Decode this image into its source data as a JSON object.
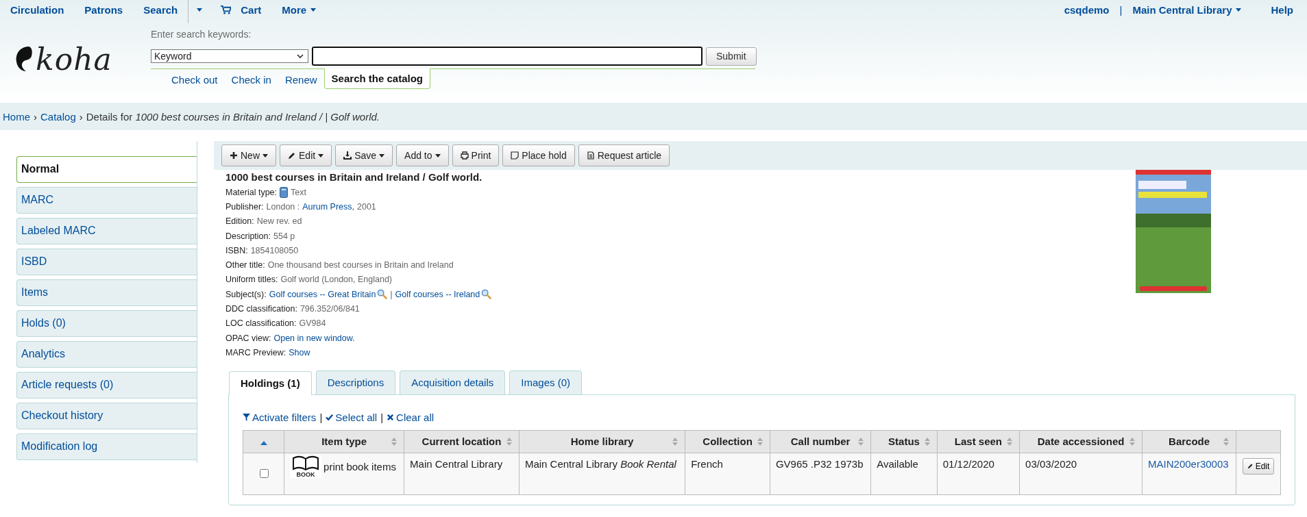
{
  "top_nav": {
    "items": [
      {
        "label": "Circulation",
        "dropdown": false
      },
      {
        "label": "Patrons",
        "dropdown": false
      },
      {
        "label": "Search",
        "dropdown": false
      },
      {
        "dropdown": true
      },
      {
        "label": "Cart",
        "dropdown": false
      },
      {
        "label": "More",
        "dropdown": true
      }
    ],
    "user": "csqdemo",
    "separator": "|",
    "library": "Main Central Library",
    "help": "Help"
  },
  "logo": {
    "text": "koha"
  },
  "search": {
    "label": "Enter search keywords:",
    "select_value": "Keyword",
    "submit": "Submit",
    "tabs": [
      {
        "label": "Check out",
        "selected": false
      },
      {
        "label": "Check in",
        "selected": false
      },
      {
        "label": "Renew",
        "selected": false
      },
      {
        "label": "Search the catalog",
        "selected": true
      }
    ]
  },
  "breadcrumb": {
    "links": [
      "Home",
      "Catalog"
    ],
    "separator": "›",
    "current": "Details for *1000 best courses in Britain and Ireland / | Golf world.*"
  },
  "sidebar": {
    "items": [
      {
        "label": "Normal",
        "selected": true
      },
      {
        "label": "MARC",
        "selected": false
      },
      {
        "label": "Labeled MARC",
        "selected": false
      },
      {
        "label": "ISBD",
        "selected": false
      },
      {
        "label": "Items",
        "selected": false
      },
      {
        "label": "Holds (0)",
        "selected": false
      },
      {
        "label": "Analytics",
        "selected": false
      },
      {
        "label": "Article requests (0)",
        "selected": false
      },
      {
        "label": "Checkout history",
        "selected": false
      },
      {
        "label": "Modification log",
        "selected": false
      }
    ]
  },
  "toolbar": [
    {
      "label": "New",
      "dropdown": true
    },
    {
      "label": "Edit",
      "dropdown": true
    },
    {
      "label": "Save",
      "dropdown": true
    },
    {
      "label": "Add to",
      "dropdown": true
    },
    {
      "label": "Print",
      "dropdown": false
    },
    {
      "label": "Place hold",
      "dropdown": false
    },
    {
      "label": "Request article",
      "dropdown": false
    }
  ],
  "record": {
    "title": "1000 best courses in Britain and Ireland / Golf world.",
    "fields": [
      {
        "label": "Material type:",
        "kind": "material",
        "parts": [
          {
            "text": "Text",
            "link": false,
            "search": false
          }
        ]
      },
      {
        "label": "Publisher:",
        "kind": "text",
        "parts": [
          {
            "text": "London :",
            "link": false,
            "search": false
          },
          {
            "text": "Aurum Press,",
            "link": true,
            "search": false
          },
          {
            "text": "2001",
            "link": false,
            "search": false
          }
        ]
      },
      {
        "label": "Edition:",
        "kind": "text",
        "parts": [
          {
            "text": "New rev. ed",
            "link": false,
            "search": false
          }
        ]
      },
      {
        "label": "Description:",
        "kind": "text",
        "parts": [
          {
            "text": "554 p",
            "link": false,
            "search": false
          }
        ]
      },
      {
        "label": "ISBN:",
        "kind": "text",
        "parts": [
          {
            "text": "1854108050",
            "link": false,
            "search": false
          }
        ]
      },
      {
        "label": "Other title:",
        "kind": "text",
        "parts": [
          {
            "text": "One thousand best courses in Britain and Ireland",
            "link": false,
            "search": false
          }
        ]
      },
      {
        "label": "Uniform titles:",
        "kind": "text",
        "parts": [
          {
            "text": "Golf world (London, England)",
            "link": false,
            "search": false
          }
        ]
      },
      {
        "label": "Subject(s):",
        "kind": "text",
        "parts": [
          {
            "text": "Golf courses -- Great Britain",
            "link": true,
            "search": true
          },
          {
            "text": "|",
            "link": false,
            "search": false
          },
          {
            "text": "Golf courses -- Ireland",
            "link": true,
            "search": true
          }
        ]
      },
      {
        "label": "DDC classification:",
        "kind": "text",
        "parts": [
          {
            "text": "796.352/06/841",
            "link": false,
            "search": false
          }
        ]
      },
      {
        "label": "LOC classification:",
        "kind": "text",
        "parts": [
          {
            "text": "GV984",
            "link": false,
            "search": false
          }
        ]
      },
      {
        "label": "OPAC view:",
        "kind": "text",
        "parts": [
          {
            "text": "Open in new window.",
            "link": true,
            "search": false
          }
        ]
      },
      {
        "label": "MARC Preview:",
        "kind": "text",
        "parts": [
          {
            "text": "Show",
            "link": true,
            "search": false
          }
        ]
      }
    ]
  },
  "tabs": [
    {
      "label": "Holdings (1)",
      "selected": true
    },
    {
      "label": "Descriptions",
      "selected": false
    },
    {
      "label": "Acquisition details",
      "selected": false
    },
    {
      "label": "Images (0)",
      "selected": false
    }
  ],
  "holdings": {
    "actions": [
      "Activate filters",
      "Select all",
      "Clear all"
    ],
    "action_separator": "|",
    "columns": [
      {
        "sortable": true,
        "sorted": true
      },
      {
        "label": "Item type",
        "sortable": true,
        "sorted": false
      },
      {
        "label": "Current location",
        "sortable": true,
        "sorted": false
      },
      {
        "label": "Home library",
        "sortable": true,
        "sorted": false
      },
      {
        "label": "Collection",
        "sortable": true,
        "sorted": false
      },
      {
        "label": "Call number",
        "sortable": true,
        "sorted": false
      },
      {
        "label": "Status",
        "sortable": true,
        "sorted": false
      },
      {
        "label": "Last seen",
        "sortable": true,
        "sorted": false
      },
      {
        "label": "Date accessioned",
        "sortable": true,
        "sorted": false
      },
      {
        "label": "Barcode",
        "sortable": true,
        "sorted": false
      },
      {
        "sortable": false
      }
    ],
    "rows": [
      {
        "checked": false,
        "item_type": "print book items",
        "item_icon_caption": "BOOK",
        "current_location": "Main Central Library",
        "home_library": "Main Central Library *Book Rental*",
        "collection": "French",
        "call_number": "GV965 .P32 1973b",
        "status": "Available",
        "last_seen": "01/12/2020",
        "date_accessioned": "03/03/2020",
        "barcode": "MAIN200er30003",
        "action": "Edit"
      }
    ]
  }
}
